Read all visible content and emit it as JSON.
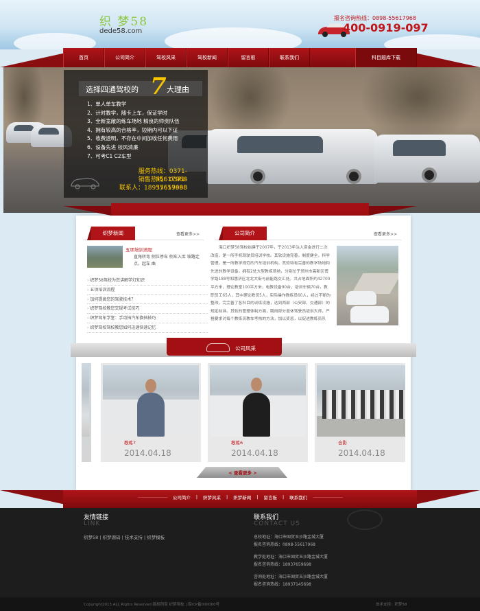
{
  "header": {
    "logo_cn": "织 梦58",
    "logo_en": "dede58.com",
    "hotline_label": "报名咨询热线：0898-55617968",
    "hotline_number": "400-0919-097",
    "logo_color": "#8cc63f",
    "accent_color": "#c01418"
  },
  "nav": {
    "items": [
      "首页",
      "公司简介",
      "驾校风采",
      "驾校新闻",
      "留言板",
      "联系我们"
    ],
    "extra": "科目题库下载"
  },
  "banner": {
    "title_prefix": "选择四通驾校的",
    "title_number": "7",
    "title_suffix": "大理由",
    "reasons": [
      "1、单人单车教学",
      "2、计时教学，随卡上车，保证学时",
      "3、全新宽敞的练车场地 精良的师资队伍",
      "4、拥有较高的合格率，短期内可以下证",
      "5、收费透明，不存在中间加收任何费用",
      "6、设备先进 校风清廉",
      "7、可考C1 C2车型"
    ],
    "service_hotline": "服务热线：0371-55617968",
    "sales_hotline": "销售热线：0371-55617968",
    "contact": "联系人：18937659698"
  },
  "news": {
    "tab": "织梦新闻",
    "more": "查看更多>>",
    "feature_title": "五项培训流程",
    "feature_desc": "直角转弯 侧位停车 侧车入库 坡路定点，起车 曲",
    "items": [
      "织梦58驾校为您讲解学灯知识",
      "五项培训流程",
      "加何提高您的驾驶技术？",
      "织梦驾校教您交规考试技巧",
      "织梦驾车学堂：手动挡汽车换挡技巧",
      "织梦驾校驾校教您如何迅速快速记忆"
    ]
  },
  "intro": {
    "tab": "公司简介",
    "more": "查看更多>>",
    "text": "海口织梦58驾校始建于2007年，于2013年注入资金进行二次改造，是一所手机驾驶员培训学校。其软设施完善，制度健全，科学管理，是一所教学规范的汽车培训机构。其软特有完善的教学场地和先进的教学设备，拥有2处大型教练场地，分别位于郑州市高新区博学路188号和惠济区北北大街与前能路交汇处。共占地面积约42700平方米，理论教室100平方米，电教设备90台，培训车辆70台，教职员工65人，其中理论教员5人，实际操作教练员60人，经过不断的整改，完完善了各科目的训练设施，达到两部（公安部、交通部）的规定标准。其软的管理体制方面，聘用部分退休驾驶员培训大师，严格要求对每个教练员教车考核的方法，加以奖惩，以促进教练员队"
  },
  "gallery": {
    "title": "公司风采",
    "cards": [
      {
        "name": "教练7",
        "date": "2014.04.18"
      },
      {
        "name": "教练6",
        "date": "2014.04.18"
      },
      {
        "name": "合影",
        "date": "2014.04.18"
      }
    ],
    "more": "< 查看更多 >"
  },
  "footer_nav": {
    "items": [
      "公司简介",
      "织梦风采",
      "织梦新闻",
      "留言板",
      "联系我们"
    ],
    "dash": "--------------------------------"
  },
  "footer": {
    "friend_title": "友情链接",
    "friend_sub": "LINK",
    "friend_links": "织梦58 | 织梦源码 | 技术支持 | 织梦模板",
    "contact_title": "联系我们",
    "contact_sub": "CONTACT US",
    "addresses": [
      {
        "addr": "总校地址：海口市国贸玉沙路金城大厦",
        "tel": "报名咨询热线：0898-55617968"
      },
      {
        "addr": "教学处地址：海口市国贸玉沙路金城大厦",
        "tel": "报名咨询热线：18937659698"
      },
      {
        "addr": "咨询处地址：海口市国贸玉沙路金城大厦",
        "tel": "报名咨询热线：18937145698"
      }
    ],
    "copyright": "Copyright2013 ALL Rights Reserved 版权所有 织梦驾校 | 琼ICP备000000号",
    "right_text": "技术支持：织梦58"
  }
}
